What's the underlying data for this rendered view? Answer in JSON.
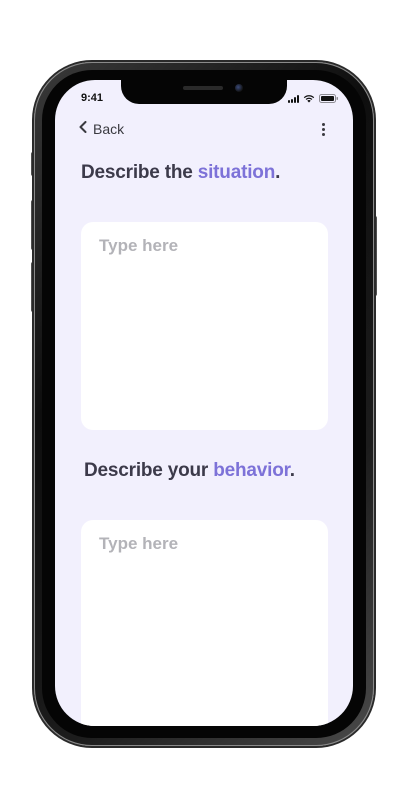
{
  "status_bar": {
    "time": "9:41"
  },
  "nav": {
    "back_label": "Back",
    "back_icon": "chevron-left-icon",
    "more_icon": "more-vertical-icon"
  },
  "form": {
    "situation": {
      "heading_prefix": "Describe the ",
      "heading_accent": "situation",
      "heading_suffix": ".",
      "placeholder": "Type here",
      "value": ""
    },
    "behavior": {
      "heading_prefix": "Describe your ",
      "heading_accent": "behavior",
      "heading_suffix": ".",
      "placeholder": "Type here",
      "value": ""
    }
  },
  "colors": {
    "screen_background": "#f2f0fd",
    "accent": "#7d72d8",
    "heading_text": "#3c3a4a",
    "placeholder_text": "#b3b3b8",
    "card_background": "#ffffff"
  }
}
